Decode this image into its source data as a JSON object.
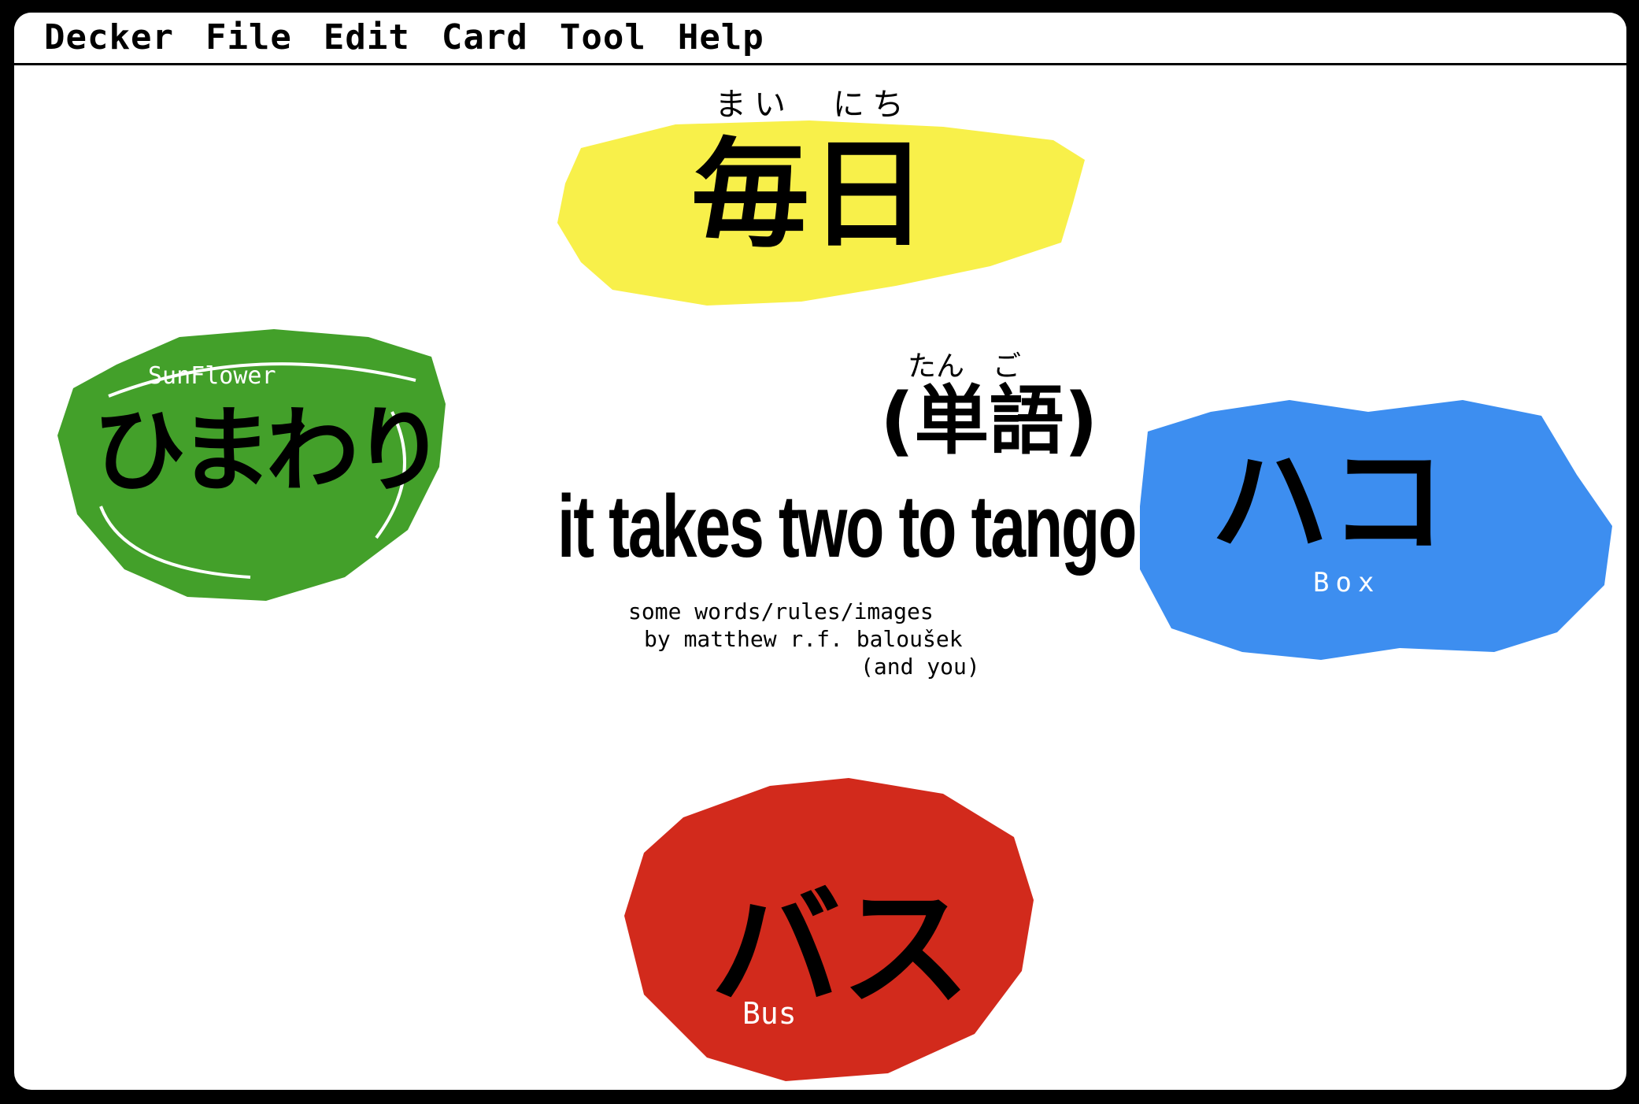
{
  "menubar": {
    "items": [
      "Decker",
      "File",
      "Edit",
      "Card",
      "Tool",
      "Help"
    ]
  },
  "title_card": {
    "mainichi": {
      "kanji": "毎日",
      "furigana": "まい　にち",
      "color": "#f8f04a"
    },
    "tango": {
      "kanji": "(単語)",
      "furigana": "たん　ご"
    },
    "title": "it takes two to tango",
    "credits": {
      "line1": "some words/rules/images",
      "line2": "by matthew r.f. baloušek",
      "line3": "(and you)"
    },
    "himawari": {
      "kana": "ひまわり",
      "label": "SunFlower",
      "color": "#43a02a"
    },
    "hako": {
      "kana": "ハコ",
      "label": "Box",
      "color": "#3d8ef0"
    },
    "basu": {
      "kana": "バス",
      "label": "Bus",
      "color": "#d22a1c"
    }
  }
}
